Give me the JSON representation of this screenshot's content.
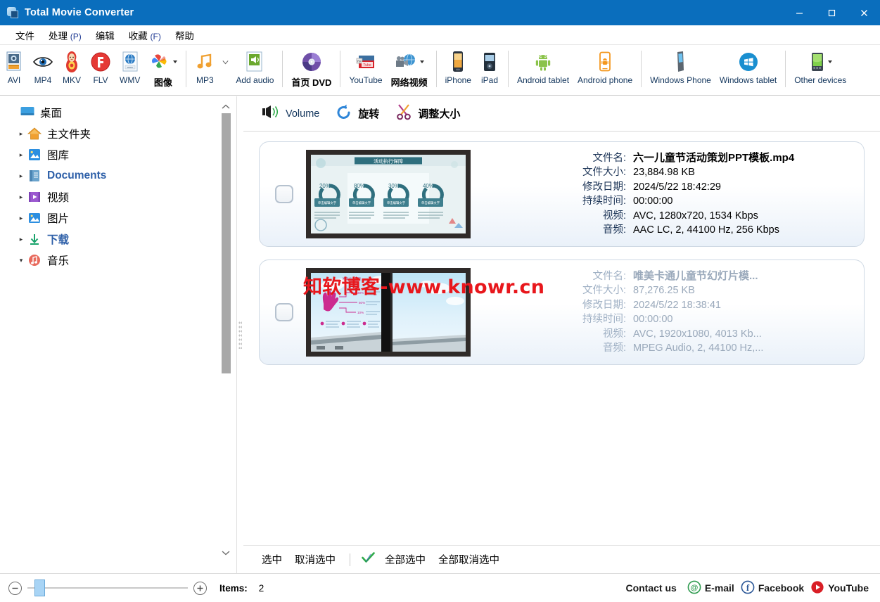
{
  "window": {
    "title": "Total Movie Converter",
    "icon": "app-icon",
    "controls": {
      "minimize": "─",
      "maximize": "□",
      "close": "✕"
    }
  },
  "menu": {
    "items": [
      {
        "label": "文件",
        "mnemonic": ""
      },
      {
        "label": "处理",
        "mnemonic": "(P)"
      },
      {
        "label": "编辑",
        "mnemonic": ""
      },
      {
        "label": "收藏",
        "mnemonic": "(F)"
      },
      {
        "label": "帮助",
        "mnemonic": ""
      }
    ]
  },
  "toolbar": {
    "buttons": [
      {
        "label": "AVI",
        "icon": "avi-file-icon",
        "cn": false,
        "dropdown": false
      },
      {
        "label": "MP4",
        "icon": "eye-icon",
        "cn": false,
        "dropdown": false
      },
      {
        "label": "MKV",
        "icon": "matryoshka-icon",
        "cn": false,
        "dropdown": false
      },
      {
        "label": "FLV",
        "icon": "flash-icon",
        "cn": false,
        "dropdown": false
      },
      {
        "label": "WMV",
        "icon": "wmv-globe-icon",
        "cn": false,
        "dropdown": false
      },
      {
        "label": "图像",
        "icon": "photos-pinwheel-icon",
        "cn": true,
        "dropdown": true
      },
      {
        "label": "MP3",
        "icon": "music-note-icon",
        "cn": false,
        "dropdown": true
      },
      {
        "label": "Add audio",
        "icon": "add-audio-icon",
        "cn": false,
        "dropdown": false
      },
      {
        "label": "首页 DVD",
        "icon": "dvd-disc-icon",
        "cn": true,
        "dropdown": false
      },
      {
        "label": "YouTube",
        "icon": "youtube-icon",
        "cn": false,
        "dropdown": false
      },
      {
        "label": "网络视频",
        "icon": "web-video-icon",
        "cn": true,
        "dropdown": true
      },
      {
        "label": "iPhone",
        "icon": "iphone-icon",
        "cn": false,
        "dropdown": false
      },
      {
        "label": "iPad",
        "icon": "ipad-icon",
        "cn": false,
        "dropdown": false
      },
      {
        "label": "Android tablet",
        "icon": "android-tablet-icon",
        "cn": false,
        "dropdown": false
      },
      {
        "label": "Android phone",
        "icon": "android-phone-icon",
        "cn": false,
        "dropdown": false
      },
      {
        "label": "Windows Phone",
        "icon": "windows-phone-icon",
        "cn": false,
        "dropdown": false
      },
      {
        "label": "Windows tablet",
        "icon": "windows-tablet-icon",
        "cn": false,
        "dropdown": false
      },
      {
        "label": "Other devices",
        "icon": "other-devices-icon",
        "cn": false,
        "dropdown": true
      }
    ]
  },
  "sidebar": {
    "items": [
      {
        "label": "桌面",
        "icon": "desktop-icon",
        "arrow": "",
        "bold": false,
        "indent": 0
      },
      {
        "label": "主文件夹",
        "icon": "home-icon",
        "arrow": "▸",
        "bold": false,
        "indent": 1
      },
      {
        "label": "图库",
        "icon": "gallery-icon",
        "arrow": "▸",
        "bold": false,
        "indent": 1
      },
      {
        "label": "Documents",
        "icon": "documents-icon",
        "arrow": "▸",
        "bold": true,
        "indent": 1
      },
      {
        "label": "视频",
        "icon": "videos-icon",
        "arrow": "▸",
        "bold": false,
        "indent": 1
      },
      {
        "label": "图片",
        "icon": "pictures-icon",
        "arrow": "▸",
        "bold": false,
        "indent": 1
      },
      {
        "label": "下载",
        "icon": "downloads-icon",
        "arrow": "▸",
        "bold": true,
        "indent": 1
      },
      {
        "label": "音乐",
        "icon": "music-icon",
        "arrow": "▾",
        "bold": false,
        "indent": 1
      }
    ]
  },
  "edit_toolbar": {
    "buttons": [
      {
        "label": "Volume",
        "icon": "volume-icon",
        "cn": false
      },
      {
        "label": "旋转",
        "icon": "rotate-icon",
        "cn": true
      },
      {
        "label": "调整大小",
        "icon": "scissors-icon",
        "cn": true
      }
    ]
  },
  "file_list": {
    "labels": {
      "name": "文件名:",
      "size": "文件大小:",
      "modified": "修改日期:",
      "duration": "持续时间:",
      "video": "视频:",
      "audio": "音频:"
    },
    "items": [
      {
        "name": "六一儿童节活动策划PPT模板.mp4",
        "size": "23,884.98 KB",
        "modified": "2024/5/22 18:42:29",
        "duration": "00:00:00",
        "video": "AVC, 1280x720, 1534 Kbps",
        "audio": "AAC LC, 2, 44100 Hz, 256 Kbps",
        "checked": false,
        "dim": false,
        "thumb": "ppt-slide-donuts"
      },
      {
        "name": "唯美卡通儿童节幻灯片模...",
        "size": "87,276.25 KB",
        "modified": "2024/5/22 18:38:41",
        "duration": "00:00:00",
        "video": "AVC, 1920x1080, 4013 Kb...",
        "audio": "MPEG Audio, 2, 44100 Hz,...",
        "checked": false,
        "dim": true,
        "thumb": "ppt-slide-sky-hand"
      }
    ]
  },
  "watermark": {
    "text": "知软博客-www.knowr.cn",
    "color": "#e8171c"
  },
  "select_bar": {
    "select": "选中",
    "deselect": "取消选中",
    "select_all": "全部选中",
    "deselect_all": "全部取消选中",
    "check_icon": "check-icon"
  },
  "status_bar": {
    "zoom_out": "⊖",
    "zoom_in": "⊕",
    "items_label": "Items:",
    "items_count": "2",
    "contact_label": "Contact us",
    "links": [
      {
        "label": "E-mail",
        "icon": "email-icon",
        "color": "#2e9b4f"
      },
      {
        "label": "Facebook",
        "icon": "facebook-icon",
        "color": "#2b5797"
      },
      {
        "label": "YouTube",
        "icon": "youtube-icon",
        "color": "#d91f26"
      }
    ]
  },
  "thumb1": {
    "title": "活动执行保障",
    "donuts": [
      "20%",
      "80%",
      "30%",
      "40%"
    ],
    "button_label": "单击编辑文字"
  },
  "thumb2": {
    "percents": [
      "30%",
      "50%",
      "10%"
    ]
  },
  "colors": {
    "titlebar": "#0a6ebd",
    "accent": "#1a5fb4",
    "watermark": "#e8171c"
  }
}
